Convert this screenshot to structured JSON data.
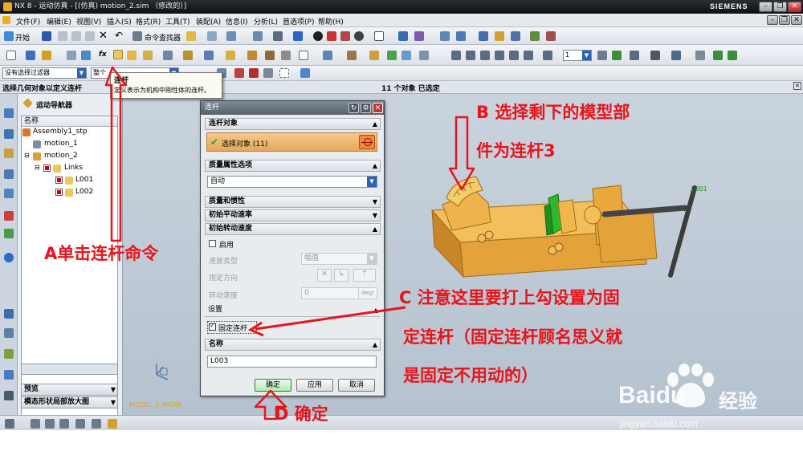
{
  "window": {
    "title": "NX 8 - 运动仿真 - [(仿真) motion_2.sim （修改的）]",
    "brand": "SIEMENS"
  },
  "menu": [
    "文件(F)",
    "编辑(E)",
    "视图(V)",
    "插入(S)",
    "格式(R)",
    "工具(T)",
    "装配(A)",
    "信息(I)",
    "分析(L)",
    "首选项(P)",
    "帮助(H)"
  ],
  "toolbar": {
    "start": "开始",
    "command_finder": "命令查找器",
    "step_value": "1"
  },
  "filters": {
    "selection_filter": "没有选择过滤器",
    "scope": "整个"
  },
  "status": {
    "prompt": "选择几何对象以定义连杆",
    "selected_count": "11 个对象 已选定"
  },
  "tooltip": {
    "title": "连杆",
    "description": "定义表示为机构中刚性体的连杆。"
  },
  "navigator": {
    "title": "运动导航器",
    "column_name": "名称",
    "tree": [
      {
        "label": "Assembly1_stp",
        "indent": 0
      },
      {
        "label": "motion_1",
        "indent": 1
      },
      {
        "label": "motion_2",
        "indent": 1
      },
      {
        "label": "Links",
        "indent": 2
      },
      {
        "label": "L001",
        "indent": 3
      },
      {
        "label": "L002",
        "indent": 3
      }
    ],
    "preview": "预览",
    "modal_view": "模态形状局部放大图"
  },
  "dialog": {
    "title": "连杆",
    "link_object_header": "连杆对象",
    "select_object": "选择对象 (11)",
    "mass_options_header": "质量属性选项",
    "mass_option_value": "自动",
    "mass_inertia_header": "质量和惯性",
    "init_trans_vel_header": "初始平动速率",
    "init_rot_vel_header": "初始转动速度",
    "enable_label": "启用",
    "vel_type_label": "速度类型",
    "vel_type_value": "幅值",
    "direction_label": "指定方向",
    "rot_speed_label": "转动速度",
    "rot_speed_value": "0",
    "rot_speed_unit": "degr",
    "settings_header": "设置",
    "fixed_link_label": "固定连杆",
    "name_header": "名称",
    "name_value": "L003",
    "ok": "确定",
    "apply": "应用",
    "cancel": "取消"
  },
  "viewport": {
    "model_label": "L001",
    "work_label": "MODEL_1 WORK"
  },
  "annotations": {
    "a": "A单击连杆命令",
    "b1": "B 选择剩下的模型部",
    "b2": "件为连杆3",
    "c1": "C 注意这里要打上勾设置为固",
    "c2": "定连杆（固定连杆顾名思义就",
    "c3": "是固定不用动的）",
    "d": "D 确定"
  },
  "watermark": {
    "brand": "Baidu",
    "suffix": "经验",
    "url": "jingyan.baidu.com"
  },
  "colors": {
    "annotation_red": "#e8141c",
    "model_orange": "#e8a83c",
    "model_green": "#2db82d",
    "selection_orange": "#e5a85a"
  }
}
